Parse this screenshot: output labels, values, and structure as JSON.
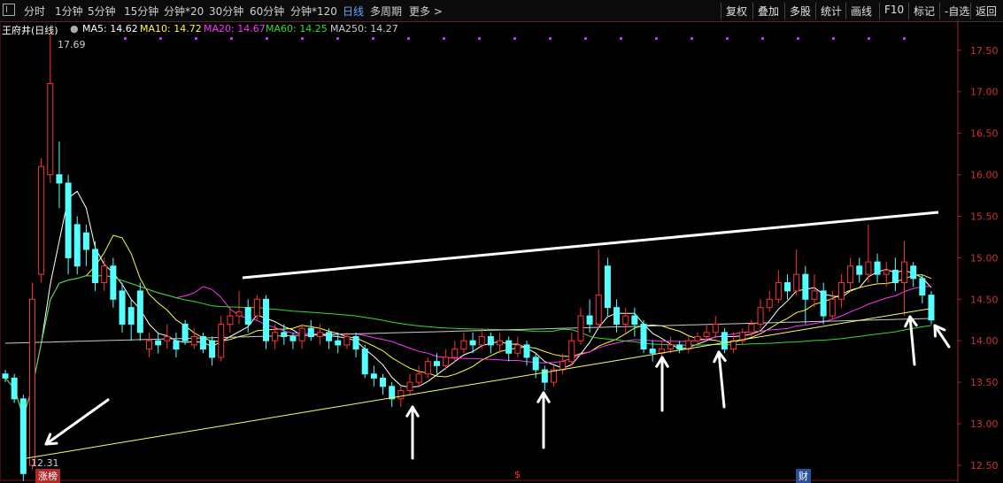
{
  "toolbar": {
    "periods": [
      {
        "label": "分时",
        "active": false
      },
      {
        "label": "1分钟",
        "active": false
      },
      {
        "label": "5分钟",
        "active": false
      },
      {
        "label": "15分钟",
        "active": false
      },
      {
        "label": "分钟*20",
        "active": false
      },
      {
        "label": "30分钟",
        "active": false
      },
      {
        "label": "60分钟",
        "active": false
      },
      {
        "label": "分钟*120",
        "active": false
      },
      {
        "label": "日线",
        "active": true
      },
      {
        "label": "多周期",
        "active": false
      },
      {
        "label": "更多",
        "active": false
      }
    ],
    "more_chevron": ">",
    "actions": [
      "复权",
      "叠加",
      "多股",
      "统计",
      "画线",
      "F10",
      "标记",
      "-自选",
      "返回"
    ]
  },
  "legend": {
    "title": "王府井(日线)",
    "items": [
      {
        "label": "MA5: 14.62",
        "color": "#ffffff"
      },
      {
        "label": "MA10: 14.72",
        "color": "#ffff33"
      },
      {
        "label": "MA20: 14.67",
        "color": "#ff33ff"
      },
      {
        "label": "MA60: 14.25",
        "color": "#33dd33"
      },
      {
        "label": "MA250: 14.27",
        "color": "#cccccc"
      }
    ]
  },
  "markers": {
    "high_label": "17.69",
    "low_label": "12.31",
    "bottom_tag": "涨榜",
    "s_tag": "$",
    "cai_tag": "财"
  },
  "chart_data": {
    "type": "candlestick",
    "y_ticks": [
      "17.50",
      "17.00",
      "16.50",
      "16.00",
      "15.50",
      "15.00",
      "14.50",
      "14.00",
      "13.50",
      "13.00",
      "12.50"
    ],
    "ylim": [
      12.35,
      17.85
    ],
    "colors": {
      "up": "#ff3232",
      "down": "#54ffff",
      "ma5": "#ffffff",
      "ma10": "#ffff33",
      "ma20": "#ff33ff",
      "ma60": "#33dd33",
      "ma250": "#cccccc"
    },
    "candles": [
      [
        13.6,
        13.55,
        13.65,
        13.5
      ],
      [
        13.55,
        13.3,
        13.6,
        13.25
      ],
      [
        13.3,
        12.4,
        13.35,
        12.31
      ],
      [
        12.5,
        14.5,
        14.7,
        12.45
      ],
      [
        14.8,
        16.1,
        16.2,
        14.7
      ],
      [
        16.0,
        17.1,
        17.69,
        15.9
      ],
      [
        16.0,
        15.9,
        16.4,
        15.6
      ],
      [
        15.9,
        15.0,
        16.0,
        14.8
      ],
      [
        15.4,
        14.9,
        15.5,
        14.8
      ],
      [
        15.3,
        15.1,
        15.4,
        14.9
      ],
      [
        15.1,
        14.7,
        15.2,
        14.6
      ],
      [
        14.7,
        14.9,
        15.0,
        14.6
      ],
      [
        14.9,
        14.5,
        15.0,
        14.4
      ],
      [
        14.6,
        14.2,
        14.7,
        14.1
      ],
      [
        14.4,
        14.2,
        14.5,
        14.0
      ],
      [
        14.6,
        14.1,
        14.7,
        14.0
      ],
      [
        13.9,
        14.0,
        14.1,
        13.8
      ],
      [
        14.0,
        13.95,
        14.1,
        13.85
      ],
      [
        14.0,
        14.05,
        14.2,
        13.9
      ],
      [
        14.0,
        13.9,
        14.1,
        13.8
      ],
      [
        14.2,
        14.0,
        14.25,
        13.95
      ],
      [
        13.95,
        14.05,
        14.15,
        13.9
      ],
      [
        14.05,
        13.9,
        14.1,
        13.85
      ],
      [
        14.0,
        13.8,
        14.05,
        13.7
      ],
      [
        13.8,
        14.2,
        14.3,
        13.75
      ],
      [
        14.2,
        14.3,
        14.4,
        14.1
      ],
      [
        14.3,
        14.35,
        14.6,
        14.2
      ],
      [
        14.4,
        14.2,
        14.5,
        14.1
      ],
      [
        14.3,
        14.5,
        14.55,
        14.25
      ],
      [
        14.5,
        14.0,
        14.55,
        13.9
      ],
      [
        14.0,
        14.1,
        14.2,
        13.9
      ],
      [
        14.1,
        14.05,
        14.2,
        13.95
      ],
      [
        14.05,
        14.0,
        14.1,
        13.9
      ],
      [
        14.0,
        14.15,
        14.2,
        13.9
      ],
      [
        14.15,
        14.05,
        14.25,
        14.0
      ],
      [
        14.05,
        14.1,
        14.2,
        13.95
      ],
      [
        14.1,
        14.0,
        14.15,
        13.9
      ],
      [
        14.0,
        13.95,
        14.1,
        13.85
      ],
      [
        13.95,
        14.05,
        14.1,
        13.9
      ],
      [
        14.05,
        13.9,
        14.1,
        13.8
      ],
      [
        13.9,
        13.6,
        13.95,
        13.55
      ],
      [
        13.6,
        13.55,
        13.7,
        13.45
      ],
      [
        13.55,
        13.45,
        13.6,
        13.35
      ],
      [
        13.45,
        13.3,
        13.5,
        13.2
      ],
      [
        13.3,
        13.4,
        13.45,
        13.2
      ],
      [
        13.4,
        13.5,
        13.6,
        13.35
      ],
      [
        13.5,
        13.6,
        13.7,
        13.45
      ],
      [
        13.6,
        13.75,
        13.8,
        13.55
      ],
      [
        13.75,
        13.7,
        13.85,
        13.6
      ],
      [
        13.7,
        13.8,
        13.9,
        13.65
      ],
      [
        13.8,
        13.9,
        14.0,
        13.75
      ],
      [
        13.9,
        14.0,
        14.1,
        13.85
      ],
      [
        14.0,
        13.95,
        14.1,
        13.85
      ],
      [
        13.95,
        14.05,
        14.15,
        13.9
      ],
      [
        14.05,
        13.95,
        14.1,
        13.85
      ],
      [
        13.95,
        14.0,
        14.1,
        13.85
      ],
      [
        14.0,
        13.85,
        14.05,
        13.75
      ],
      [
        13.85,
        13.95,
        14.05,
        13.8
      ],
      [
        13.95,
        13.8,
        14.0,
        13.7
      ],
      [
        13.8,
        13.65,
        13.85,
        13.55
      ],
      [
        13.65,
        13.5,
        13.7,
        13.4
      ],
      [
        13.5,
        13.65,
        13.7,
        13.45
      ],
      [
        13.65,
        13.75,
        13.85,
        13.6
      ],
      [
        13.75,
        14.0,
        14.1,
        13.7
      ],
      [
        14.0,
        14.3,
        14.4,
        13.95
      ],
      [
        14.3,
        14.2,
        14.5,
        14.1
      ],
      [
        14.2,
        14.55,
        15.1,
        14.15
      ],
      [
        14.9,
        14.4,
        15.0,
        14.3
      ],
      [
        14.4,
        14.2,
        14.5,
        14.1
      ],
      [
        14.2,
        14.3,
        14.4,
        14.1
      ],
      [
        14.3,
        14.2,
        14.4,
        14.05
      ],
      [
        14.2,
        13.9,
        14.25,
        13.85
      ],
      [
        13.9,
        13.85,
        14.0,
        13.75
      ],
      [
        13.85,
        13.9,
        14.0,
        13.8
      ],
      [
        13.9,
        13.95,
        14.05,
        13.85
      ],
      [
        13.95,
        13.9,
        14.0,
        13.85
      ],
      [
        13.9,
        14.0,
        14.05,
        13.85
      ],
      [
        14.0,
        14.05,
        14.1,
        13.95
      ],
      [
        14.05,
        14.1,
        14.2,
        14.0
      ],
      [
        14.1,
        14.2,
        14.3,
        14.05
      ],
      [
        14.1,
        13.9,
        14.15,
        13.85
      ],
      [
        13.9,
        14.0,
        14.1,
        13.85
      ],
      [
        14.0,
        14.1,
        14.15,
        13.95
      ],
      [
        14.1,
        14.2,
        14.25,
        14.05
      ],
      [
        14.2,
        14.4,
        14.5,
        14.15
      ],
      [
        14.4,
        14.5,
        14.6,
        14.35
      ],
      [
        14.5,
        14.7,
        14.85,
        14.45
      ],
      [
        14.7,
        14.6,
        14.8,
        14.5
      ],
      [
        14.6,
        14.8,
        15.1,
        14.55
      ],
      [
        14.8,
        14.5,
        14.9,
        14.2
      ],
      [
        14.5,
        14.6,
        14.8,
        14.4
      ],
      [
        14.6,
        14.3,
        14.7,
        14.2
      ],
      [
        14.3,
        14.5,
        14.6,
        14.25
      ],
      [
        14.5,
        14.7,
        14.8,
        14.4
      ],
      [
        14.7,
        14.9,
        15.0,
        14.6
      ],
      [
        14.9,
        14.8,
        15.0,
        14.7
      ],
      [
        14.8,
        14.95,
        15.4,
        14.7
      ],
      [
        14.95,
        14.8,
        15.05,
        14.7
      ],
      [
        14.8,
        14.85,
        14.95,
        14.65
      ],
      [
        14.85,
        14.7,
        15.0,
        14.6
      ],
      [
        14.7,
        14.95,
        15.2,
        14.3
      ],
      [
        14.9,
        14.75,
        14.95,
        14.65
      ],
      [
        14.75,
        14.55,
        14.8,
        14.45
      ],
      [
        14.55,
        14.25,
        14.6,
        14.2
      ]
    ]
  }
}
